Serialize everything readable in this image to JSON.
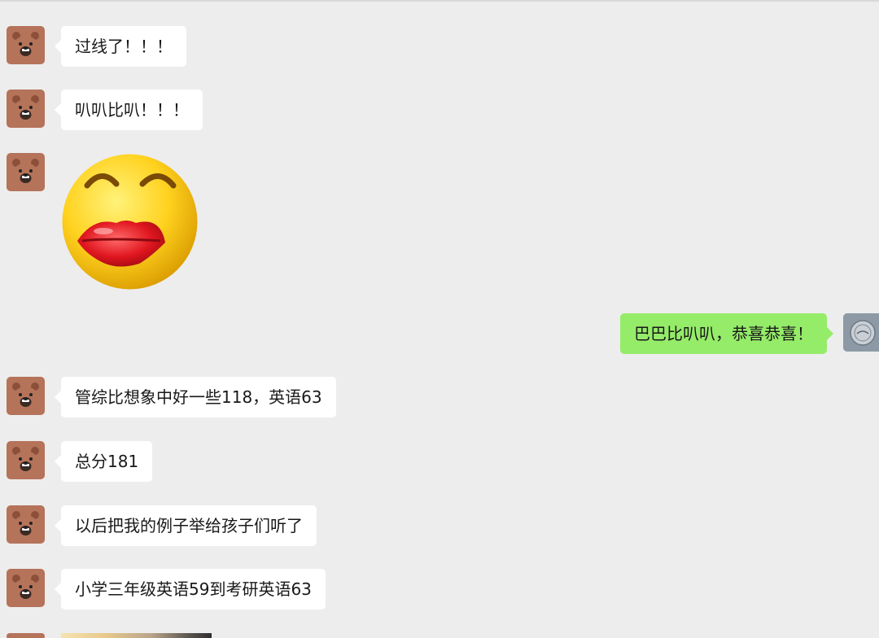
{
  "messages": [
    {
      "side": "in",
      "kind": "text",
      "text": "过线了！！！"
    },
    {
      "side": "in",
      "kind": "text",
      "text": "叭叭比叭！！！"
    },
    {
      "side": "in",
      "kind": "sticker",
      "sticker": "kiss-emoji"
    },
    {
      "side": "out",
      "kind": "text",
      "text": "巴巴比叭叭，恭喜恭喜！"
    },
    {
      "side": "in",
      "kind": "text",
      "text": "管综比想象中好一些118，英语63"
    },
    {
      "side": "in",
      "kind": "text",
      "text": "总分181"
    },
    {
      "side": "in",
      "kind": "text",
      "text": "以后把我的例子举给孩子们听了"
    },
    {
      "side": "in",
      "kind": "text",
      "text": "小学三年级英语59到考研英语63"
    },
    {
      "side": "in",
      "kind": "image",
      "image": "photo-thumbnail"
    }
  ],
  "colors": {
    "background": "#ededed",
    "incoming_bubble": "#ffffff",
    "outgoing_bubble": "#95ec69",
    "contact_avatar": "#b5735a"
  },
  "icons": {
    "contact_avatar": "bear-avatar-icon",
    "self_avatar": "profile-avatar-icon",
    "sticker": "kiss-emoji-sticker"
  }
}
